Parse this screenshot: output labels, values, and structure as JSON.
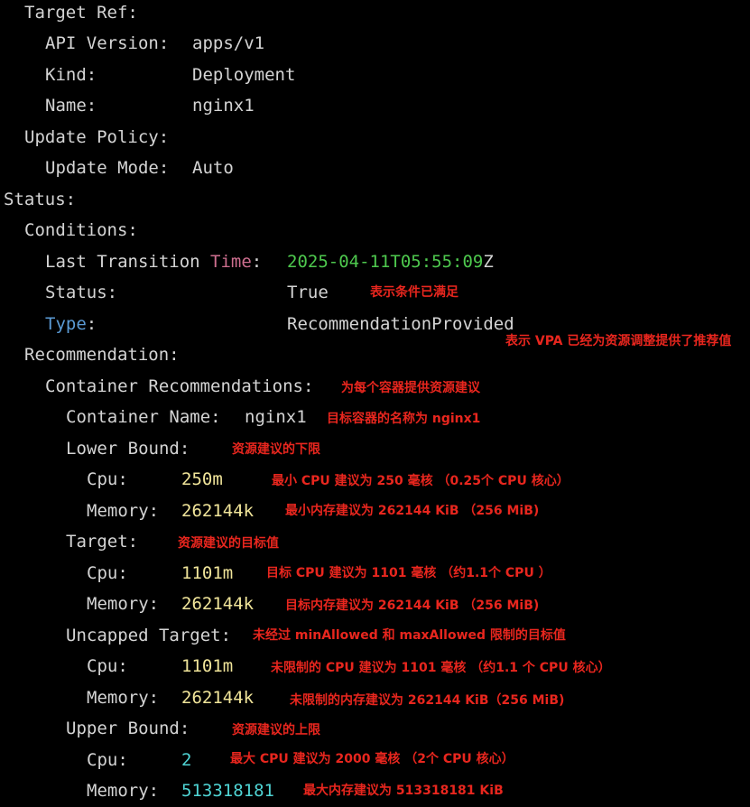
{
  "lines": {
    "target_ref": "Target Ref:",
    "api_version_key": "API Version:",
    "api_version_val": "apps/v1",
    "kind_key": "Kind:",
    "kind_val": "Deployment",
    "name_key": "Name:",
    "name_val": "nginx1",
    "update_policy": "Update Policy:",
    "update_mode_key": "Update Mode:",
    "update_mode_val": "Auto",
    "status_root": "Status:",
    "conditions": "Conditions:",
    "last_transition_prefix": "Last Transition ",
    "last_transition_time_word": "Time",
    "last_transition_colon": ":",
    "last_transition_ts": "2025-04-11T05:55:09",
    "last_transition_z": "Z",
    "cond_status_key": "Status:",
    "cond_status_val": "True",
    "type_key": "Type",
    "type_colon": ":",
    "type_val": "RecommendationProvided",
    "recommendation": "Recommendation:",
    "container_recommendations": "Container Recommendations:",
    "container_name_key": "Container Name:",
    "container_name_val": "nginx1",
    "lower_bound": "Lower Bound:",
    "lb_cpu_key": "Cpu:",
    "lb_cpu_val": "250m",
    "lb_mem_key": "Memory:",
    "lb_mem_val": "262144k",
    "target": "Target:",
    "t_cpu_key": "Cpu:",
    "t_cpu_val": "1101m",
    "t_mem_key": "Memory:",
    "t_mem_val": "262144k",
    "uncapped_target": "Uncapped Target:",
    "u_cpu_key": "Cpu:",
    "u_cpu_val": "1101m",
    "u_mem_key": "Memory:",
    "u_mem_val": "262144k",
    "upper_bound": "Upper Bound:",
    "ub_cpu_key": "Cpu:",
    "ub_cpu_val": "2",
    "ub_mem_key": "Memory:",
    "ub_mem_val": "513318181"
  },
  "annotations": {
    "status_true": "表示条件已满足",
    "recommendation_provided": "表示 VPA 已经为资源调整提供了推荐值",
    "container_recommendations": "为每个容器提供资源建议",
    "container_name": "目标容器的名称为 nginx1",
    "lower_bound": "资源建议的下限",
    "lb_cpu": "最小 CPU 建议为 250 毫核 （0.25个 CPU 核心）",
    "lb_mem": "最小内存建议为 262144 KiB （256 MiB)",
    "target": "资源建议的目标值",
    "t_cpu": "目标 CPU 建议为 1101 毫核 （约1.1个 CPU ）",
    "t_mem": "目标内存建议为 262144 KiB （256 MiB)",
    "uncapped_target": "未经过 minAllowed 和 maxAllowed 限制的目标值",
    "u_cpu": "未限制的 CPU 建议为 1101 毫核 （约1.1 个 CPU 核心）",
    "u_mem": "未限制的内存建议为 262144 KiB（256 MiB)",
    "upper_bound": "资源建议的上限",
    "ub_cpu": "最大 CPU 建议为 2000 毫核 （2个 CPU 核心）",
    "ub_mem": "最大内存建议为 513318181 KiB"
  },
  "colors": {
    "background": "#000000",
    "text": "#d4d4d4",
    "annotation": "#e8261e",
    "timestamp": "#4ec94e",
    "time_keyword": "#ce6f8f",
    "type_keyword": "#5b9bd5",
    "value_yellow": "#f1e59a",
    "value_cyan": "#4fd4d4"
  }
}
